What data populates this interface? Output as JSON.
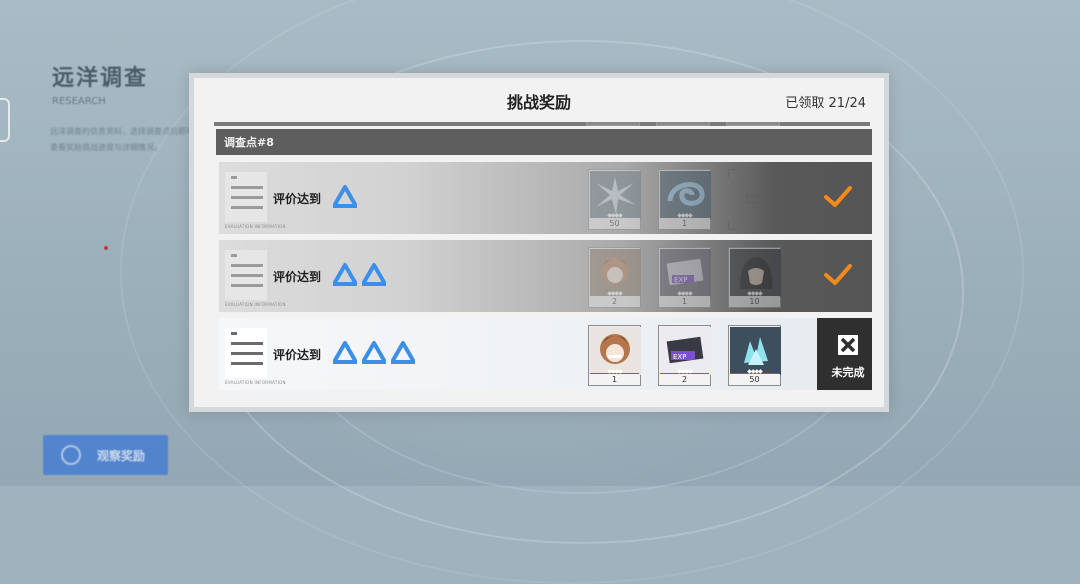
{
  "background": {
    "title": "远洋调查",
    "subtitle": "RESEARCH",
    "description": "远洋调查的信息资料，选择调查点后即可查看奖励挑战进度与详细情况。",
    "button_label": "观察奖励"
  },
  "dialog": {
    "title": "挑战奖励",
    "claimed": "已领取 21/24"
  },
  "section": {
    "label": "调查点#8"
  },
  "rows": [
    {
      "label": "评价达到",
      "micro": "EVALUATION INFORMATION",
      "triangles": 1,
      "status": "claimed",
      "rewards": [
        {
          "icon": "ice-crystal-item",
          "qty": "50"
        },
        {
          "icon": "blue-swirl-item",
          "qty": "1"
        },
        {
          "icon": "empty-slot",
          "qty": ""
        }
      ]
    },
    {
      "label": "评价达到",
      "micro": "EVALUATION INFORMATION",
      "triangles": 2,
      "status": "claimed",
      "rewards": [
        {
          "icon": "character-avatar-item",
          "qty": "2"
        },
        {
          "icon": "exp-ticket-item",
          "qty": "1"
        },
        {
          "icon": "dark-hair-character-item",
          "qty": "10"
        }
      ]
    },
    {
      "label": "评价达到",
      "micro": "EVALUATION INFORMATION",
      "triangles": 3,
      "status": "incomplete",
      "status_label": "未完成",
      "rewards": [
        {
          "icon": "character-avatar-item",
          "qty": "1"
        },
        {
          "icon": "exp-ticket-item",
          "qty": "2"
        },
        {
          "icon": "crystal-cluster-item",
          "qty": "50"
        }
      ]
    }
  ],
  "colors": {
    "triangle": "#3b8fe8",
    "check": "#f28a1c",
    "section_bar": "#5e5e5e",
    "status_button": "#2f2f2f"
  }
}
